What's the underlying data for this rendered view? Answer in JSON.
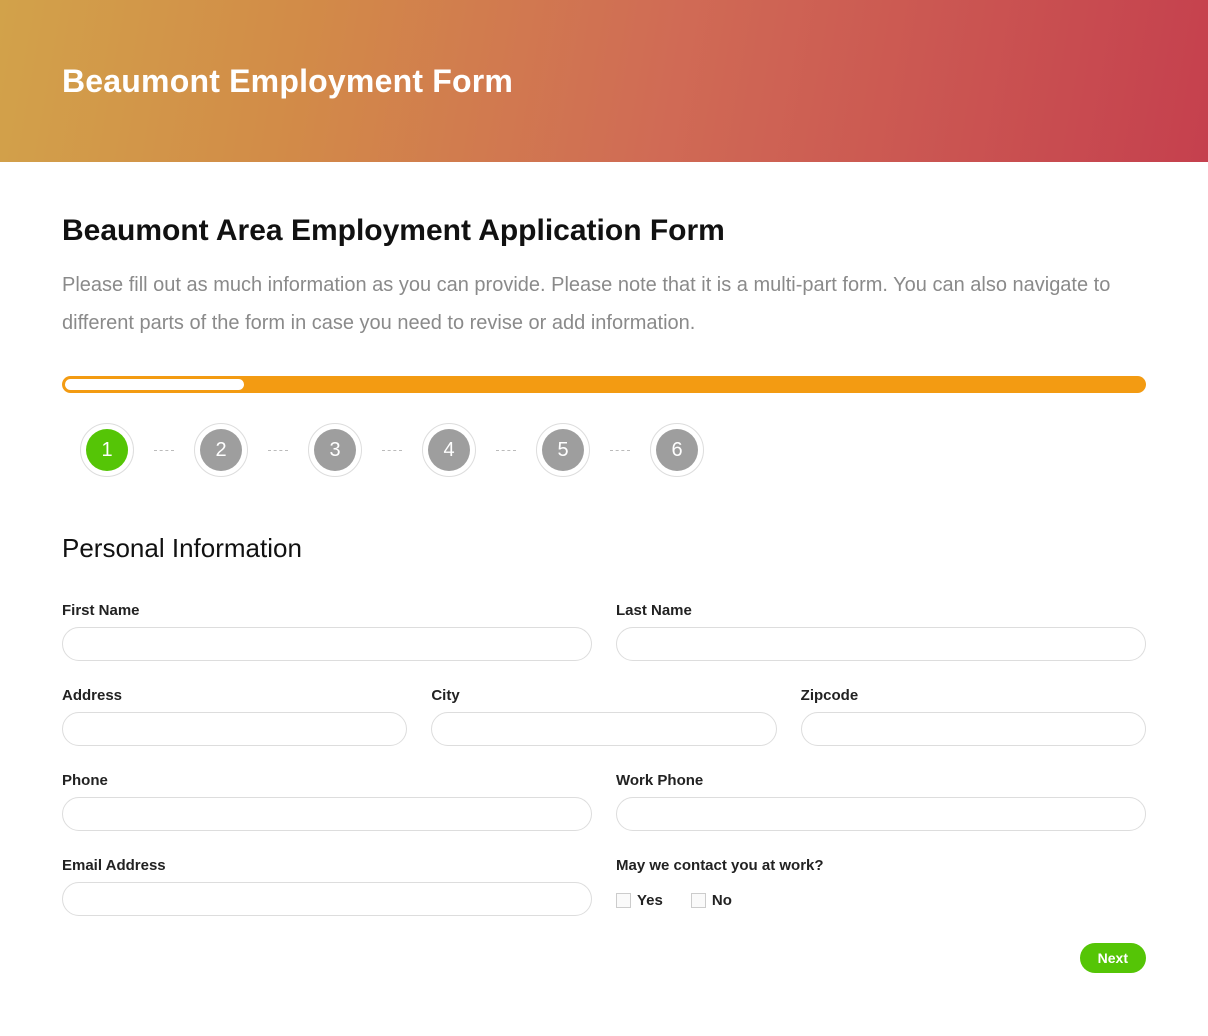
{
  "hero": {
    "title": "Beaumont Employment Form"
  },
  "page": {
    "title": "Beaumont Area Employment Application Form",
    "intro": "Please fill out as much information as you can provide. Please note that it is a multi-part form. You can also navigate to different parts of the form in case you need to revise or add information."
  },
  "progress": {
    "percent": 16.5,
    "steps": [
      {
        "num": "1",
        "active": true
      },
      {
        "num": "2",
        "active": false
      },
      {
        "num": "3",
        "active": false
      },
      {
        "num": "4",
        "active": false
      },
      {
        "num": "5",
        "active": false
      },
      {
        "num": "6",
        "active": false
      }
    ]
  },
  "section": {
    "title": "Personal Information"
  },
  "fields": {
    "first_name": {
      "label": "First Name",
      "value": ""
    },
    "last_name": {
      "label": "Last Name",
      "value": ""
    },
    "address": {
      "label": "Address",
      "value": ""
    },
    "city": {
      "label": "City",
      "value": ""
    },
    "zipcode": {
      "label": "Zipcode",
      "value": ""
    },
    "phone": {
      "label": "Phone",
      "value": ""
    },
    "work_phone": {
      "label": "Work Phone",
      "value": ""
    },
    "email": {
      "label": "Email Address",
      "value": ""
    },
    "contact_at_work": {
      "label": "May we contact you at work?",
      "options": {
        "yes": "Yes",
        "no": "No"
      }
    }
  },
  "actions": {
    "next": "Next"
  },
  "colors": {
    "accent_orange": "#f39b12",
    "accent_green": "#55c506",
    "step_inactive": "#9e9e9e"
  }
}
